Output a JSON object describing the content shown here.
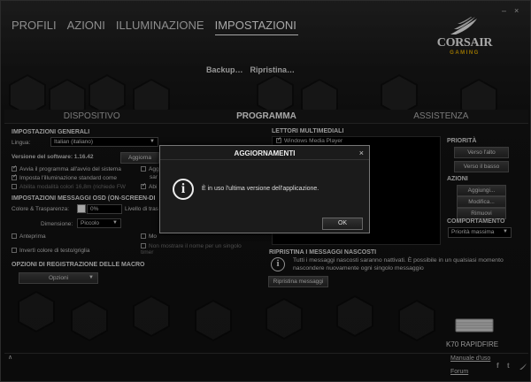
{
  "window": {
    "minimize_glyph": "–",
    "close_glyph": "×"
  },
  "topnav": [
    "PROFILI",
    "AZIONI",
    "ILLUMINAZIONE",
    "IMPOSTAZIONI"
  ],
  "topnav_active": "IMPOSTAZIONI",
  "logo": {
    "brand": "CORSAIR",
    "tagline": "GAMING"
  },
  "backup_label": "Backup…",
  "restore_label": "Ripristina…",
  "subtabs": [
    "DISPOSITIVO",
    "PROGRAMMA",
    "ASSISTENZA"
  ],
  "subtabs_active": "PROGRAMMA",
  "general": {
    "title": "IMPOSTAZIONI GENERALI",
    "language_label": "Lingua:",
    "language_value": "Italian (italiano)",
    "version_label": "Versione del software: 1.16.42",
    "update_button": "Aggiorna",
    "cb_start": "Avvia il programma all'avvio del sistema",
    "cb_lighting": "Imposta l'illuminazione standard come",
    "cb_16m": "Abilita modalità colori 16,8m (richiede FW",
    "cb_partial_1": "Agg",
    "cb_partial_1b": "sar",
    "cb_partial_2": "Abi"
  },
  "osd": {
    "title": "IMPOSTAZIONI MESSAGGI OSD (ON-SCREEN-DI",
    "color_label": "Colore & Trasparenza:",
    "transparency_value": "0%",
    "level_label": "Livello di tras",
    "size_label": "Dimensione:",
    "size_value": "Piccolo",
    "cb_preview": "Anteprima",
    "cb_invert": "Invertì colore di testo/griglia",
    "cb_mod_partial": "Mo",
    "cb_noname": "Non mostrare il nome per un singolo timer"
  },
  "macro": {
    "title": "OPZIONI DI REGISTRAZIONE DELLE MACRO",
    "options_button": "Opzioni"
  },
  "media": {
    "title": "LETTORI MULTIMEDIALI",
    "item": "Windows Media Player"
  },
  "priority": {
    "title": "PRIORITÀ",
    "up": "Verso l'alto",
    "down": "Verso il basso"
  },
  "actions": {
    "title": "AZIONI",
    "add": "Aggiungi...",
    "edit": "Modifica...",
    "remove": "Rimuovi"
  },
  "behavior": {
    "title": "COMPORTAMENTO",
    "value": "Priorità massima"
  },
  "hidden_messages": {
    "title": "RIPRISTINA I MESSAGGI NASCOSTI",
    "text": "Tutti i messaggi nascosti saranno nattivati. È possibile in un qualsiasi momento nascondere nuovamente ogni singolo messaggio",
    "button": "Ripristina messaggi"
  },
  "device": {
    "name": "K70 RAPIDFIRE"
  },
  "footer": {
    "up_arrow": "∧",
    "manual_link": "Manuale d'uso",
    "forum_link": "Forum",
    "social_f": "f",
    "social_t": "t"
  },
  "dialog": {
    "title": "AGGIORNAMENTI",
    "close": "×",
    "message": "È in uso l'ultima versione dell'applicazione.",
    "ok": "OK"
  }
}
